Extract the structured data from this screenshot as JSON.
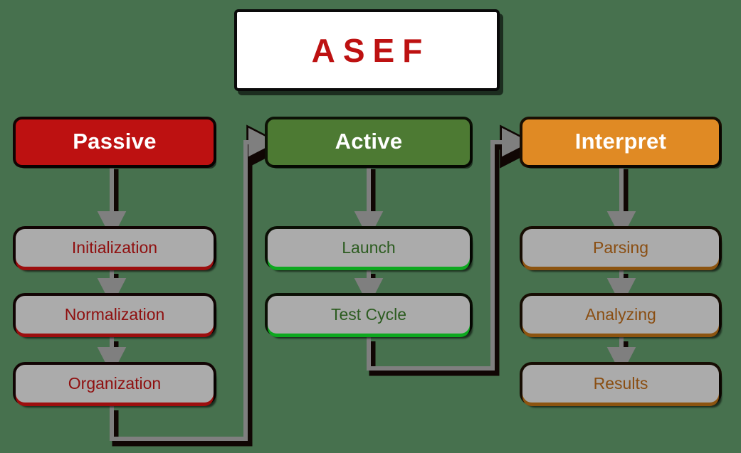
{
  "diagram": {
    "title": "ASEF",
    "background_color": "#47714e",
    "columns": [
      {
        "id": "passive",
        "header": "Passive",
        "header_color": "#bd1111",
        "text_color": "#8f0f0f",
        "steps": [
          "Initialization",
          "Normalization",
          "Organization"
        ]
      },
      {
        "id": "active",
        "header": "Active",
        "header_color": "#4d7a33",
        "text_color": "#2c5c20",
        "steps": [
          "Launch",
          "Test Cycle"
        ]
      },
      {
        "id": "interpret",
        "header": "Interpret",
        "header_color": "#e08a24",
        "text_color": "#8a4e12",
        "steps": [
          "Parsing",
          "Analyzing",
          "Results"
        ]
      }
    ],
    "box_fill_color": "#ababab",
    "arrow_color": "#7f7f7f",
    "flow": [
      "Passive → Initialization → Normalization → Organization",
      "Organization → Active",
      "Active → Launch → Test Cycle",
      "Test Cycle → Interpret",
      "Interpret → Parsing → Analyzing → Results"
    ]
  }
}
